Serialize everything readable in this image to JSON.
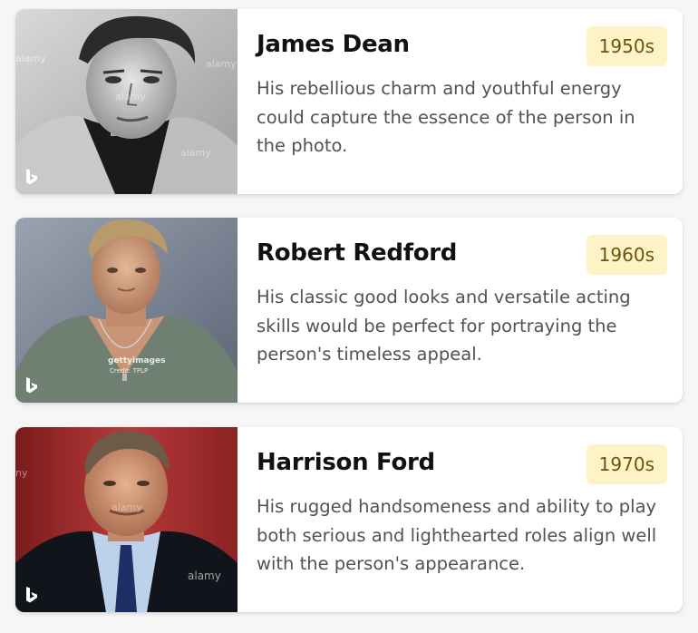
{
  "cards": [
    {
      "name": "James Dean",
      "decade": "1950s",
      "description": "His rebellious charm and youthful energy could capture the essence of the person in the photo.",
      "watermark": "alamy"
    },
    {
      "name": "Robert Redford",
      "decade": "1960s",
      "description": "His classic good looks and versatile acting skills would be perfect for portraying the person's timeless appeal.",
      "watermark": "gettyimages",
      "credit": "Credit: TPLP"
    },
    {
      "name": "Harrison Ford",
      "decade": "1970s",
      "description": "His rugged handsomeness and ability to play both serious and lighthearted roles align well with the person's appearance.",
      "watermark": "alamy"
    }
  ],
  "colors": {
    "badge_bg": "#fdf3c7",
    "badge_text": "#6b5410",
    "title_text": "#111111",
    "body_text": "#4d5357"
  },
  "icons": {
    "source": "bing-icon"
  }
}
